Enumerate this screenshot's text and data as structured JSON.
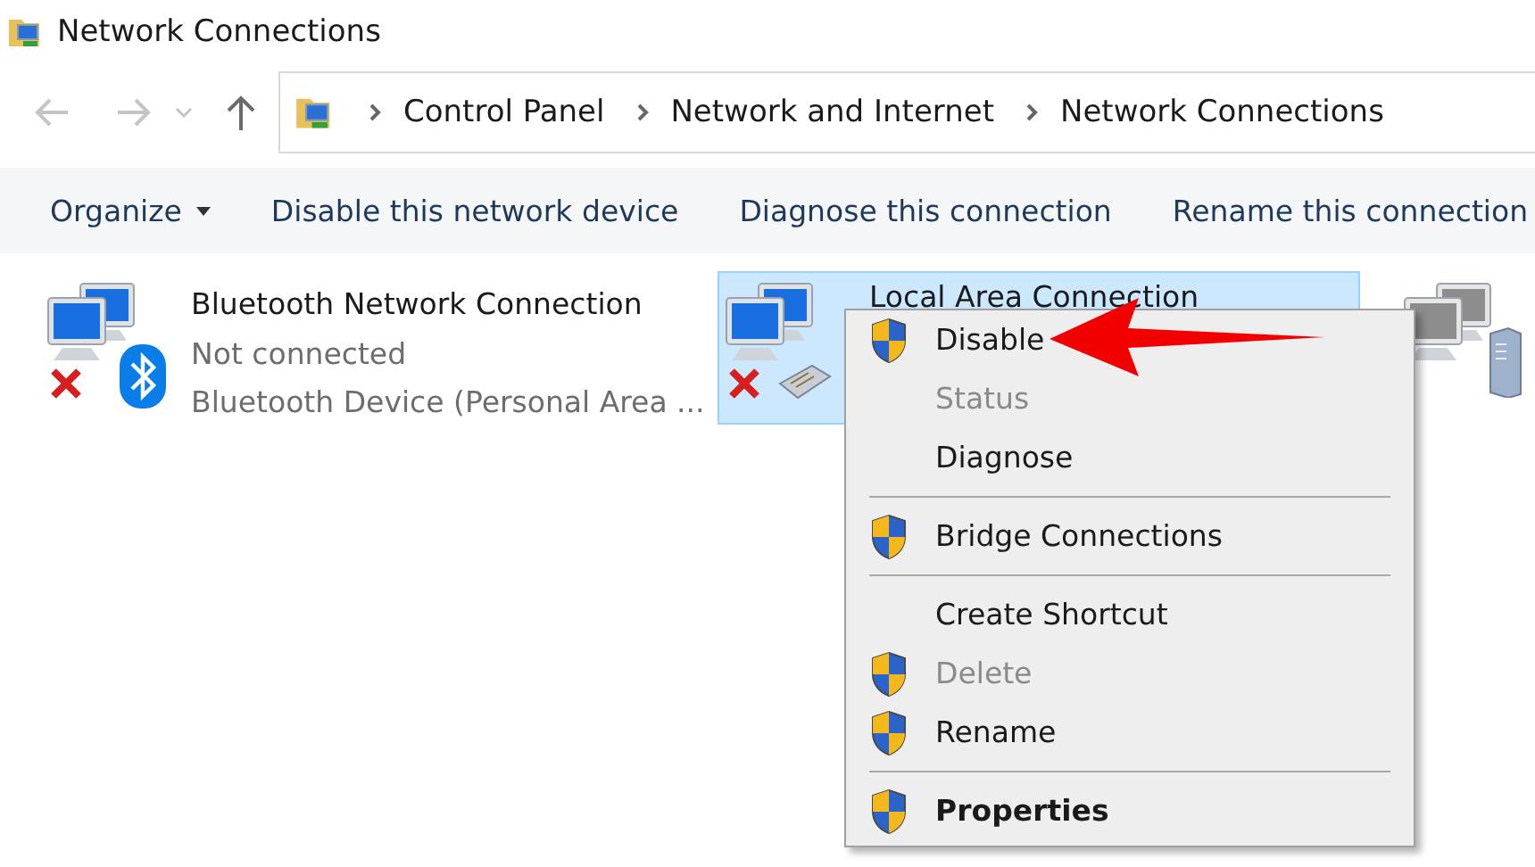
{
  "window": {
    "title": "Network Connections"
  },
  "breadcrumb": [
    "Control Panel",
    "Network and Internet",
    "Network Connections"
  ],
  "toolbar": [
    {
      "label": "Organize",
      "dropdown": true
    },
    {
      "label": "Disable this network device",
      "dropdown": false
    },
    {
      "label": "Diagnose this connection",
      "dropdown": false
    },
    {
      "label": "Rename this connection",
      "dropdown": false
    }
  ],
  "connections": [
    {
      "kind": "bluetooth",
      "name": "Bluetooth Network Connection",
      "status": "Not connected",
      "device": "Bluetooth Device (Personal Area ...",
      "selected": false,
      "disconnected": true
    },
    {
      "kind": "ethernet",
      "name": "Local Area Connection",
      "selected": true,
      "disconnected": true
    },
    {
      "kind": "server",
      "selected": false,
      "disconnected": false
    }
  ],
  "context_menu": [
    {
      "kind": "item",
      "label": "Disable",
      "shield": true,
      "disabled": false,
      "bold": false
    },
    {
      "kind": "item",
      "label": "Status",
      "shield": false,
      "disabled": true,
      "bold": false
    },
    {
      "kind": "item",
      "label": "Diagnose",
      "shield": false,
      "disabled": false,
      "bold": false
    },
    {
      "kind": "separator"
    },
    {
      "kind": "item",
      "label": "Bridge Connections",
      "shield": true,
      "disabled": false,
      "bold": false
    },
    {
      "kind": "separator"
    },
    {
      "kind": "item",
      "label": "Create Shortcut",
      "shield": false,
      "disabled": false,
      "bold": false
    },
    {
      "kind": "item",
      "label": "Delete",
      "shield": true,
      "disabled": true,
      "bold": false
    },
    {
      "kind": "item",
      "label": "Rename",
      "shield": true,
      "disabled": false,
      "bold": false
    },
    {
      "kind": "separator"
    },
    {
      "kind": "item",
      "label": "Properties",
      "shield": true,
      "disabled": false,
      "bold": true
    }
  ]
}
